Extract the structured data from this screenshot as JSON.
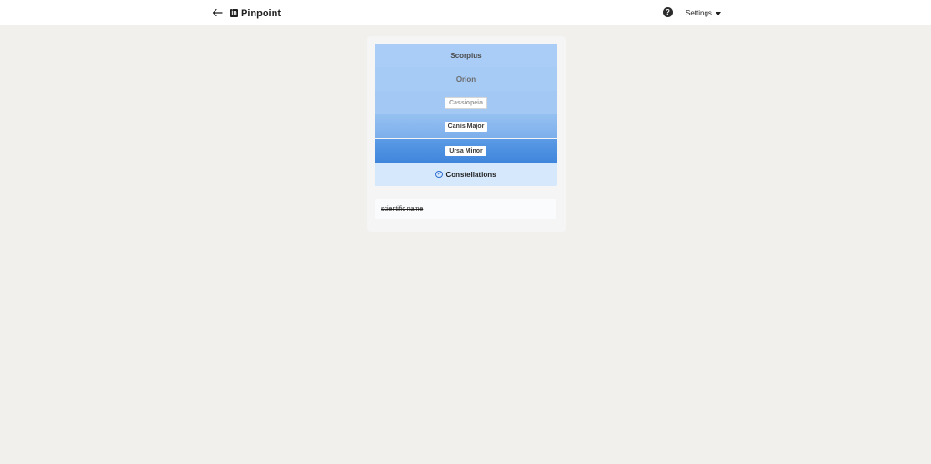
{
  "header": {
    "app_name": "Pinpoint",
    "logo_letter": "in",
    "back_icon": "arrow-left-icon",
    "help_glyph": "?",
    "settings_label": "Settings"
  },
  "stack": {
    "rows": [
      {
        "label": "Scorpius",
        "style": "plain",
        "color": "#a9cdf6"
      },
      {
        "label": "Orion",
        "style": "plain-muted",
        "color": "#a6cbf5"
      },
      {
        "label": "Cassiopeia",
        "style": "chip-faded",
        "color": "#a3c8f4"
      },
      {
        "label": "Canis Major",
        "style": "chip",
        "color": "#8dbaef"
      },
      {
        "label": "Ursa Minor",
        "style": "chip",
        "color": "#4d8fe0"
      }
    ],
    "footer_label": "Constellations",
    "footer_icon": "check-circle-icon"
  },
  "input": {
    "value": "scientific name"
  }
}
